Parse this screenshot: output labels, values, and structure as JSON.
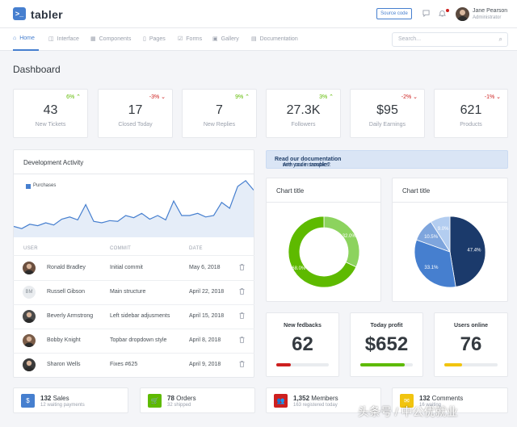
{
  "brand": {
    "name": "tabler",
    "logo_icon": "terminal-icon",
    "accent": "#467fcf"
  },
  "header": {
    "source_button": "Source code",
    "user": {
      "name": "Jane Pearson",
      "role": "Administrator"
    }
  },
  "nav": {
    "items": [
      {
        "label": "Home",
        "icon": "home-icon",
        "active": true
      },
      {
        "label": "Interface",
        "icon": "box-icon"
      },
      {
        "label": "Components",
        "icon": "calendar-icon"
      },
      {
        "label": "Pages",
        "icon": "file-icon"
      },
      {
        "label": "Forms",
        "icon": "check-square-icon"
      },
      {
        "label": "Gallery",
        "icon": "image-icon"
      },
      {
        "label": "Documentation",
        "icon": "file-text-icon"
      }
    ],
    "search_placeholder": "Search..."
  },
  "page": {
    "title": "Dashboard"
  },
  "stats": [
    {
      "value": "43",
      "label": "New Tickets",
      "change": "6%",
      "trend": "up"
    },
    {
      "value": "17",
      "label": "Closed Today",
      "change": "-3%",
      "trend": "down"
    },
    {
      "value": "7",
      "label": "New Replies",
      "change": "9%",
      "trend": "up"
    },
    {
      "value": "27.3K",
      "label": "Followers",
      "change": "3%",
      "trend": "up"
    },
    {
      "value": "$95",
      "label": "Daily Earnings",
      "change": "-2%",
      "trend": "down"
    },
    {
      "value": "621",
      "label": "Products",
      "change": "-1%",
      "trend": "down"
    }
  ],
  "dev": {
    "title": "Development Activity",
    "legend": "Purchases",
    "columns": [
      "USER",
      "COMMIT",
      "DATE"
    ],
    "rows": [
      {
        "user": "Ronald Bradley",
        "commit": "Initial commit",
        "date": "May 6, 2018",
        "initials": ""
      },
      {
        "user": "Russell Gibson",
        "commit": "Main structure",
        "date": "April 22, 2018",
        "initials": "BM"
      },
      {
        "user": "Beverly Armstrong",
        "commit": "Left sidebar adjusments",
        "date": "April 15, 2018",
        "initials": ""
      },
      {
        "user": "Bobby Knight",
        "commit": "Topbar dropdown style",
        "date": "April 8, 2018",
        "initials": ""
      },
      {
        "user": "Sharon Wells",
        "commit": "Fixes #625",
        "date": "April 9, 2018",
        "initials": ""
      }
    ]
  },
  "alert": {
    "prefix": "Are you in trouble? ",
    "link": "Read our documentation",
    "suffix": " with code samples."
  },
  "chart_data": [
    {
      "type": "area",
      "series": [
        {
          "name": "Purchases",
          "values": [
            15,
            12,
            18,
            16,
            20,
            17,
            25,
            28,
            24,
            45,
            22,
            20,
            23,
            22,
            30,
            27,
            33,
            25,
            30,
            24,
            50,
            30,
            30,
            33,
            28,
            30,
            48,
            40,
            70,
            78,
            65
          ]
        }
      ],
      "color": "#467fcf"
    },
    {
      "type": "pie",
      "title": "Chart title",
      "variant": "donut",
      "labels": [
        "32.0%",
        "68.0%"
      ],
      "values": [
        32.0,
        68.0
      ],
      "colors": [
        "#8cd35e",
        "#5eba00"
      ]
    },
    {
      "type": "pie",
      "title": "Chart title",
      "labels": [
        "47.4%",
        "33.1%",
        "10.5%",
        "9.0%"
      ],
      "values": [
        47.4,
        33.1,
        10.5,
        9.0
      ],
      "colors": [
        "#1b3a6b",
        "#467fcf",
        "#7ea5dd",
        "#b3cdf0"
      ]
    }
  ],
  "kpis": [
    {
      "title": "New fedbacks",
      "value": "62",
      "progress": 0.28,
      "color": "#cd201f"
    },
    {
      "title": "Today profit",
      "value": "$652",
      "progress": 0.84,
      "color": "#5eba00"
    },
    {
      "title": "Users online",
      "value": "76",
      "progress": 0.34,
      "color": "#f1c40f"
    }
  ],
  "bottom": [
    {
      "icon": "dollar-icon",
      "color": "#467fcf",
      "count": "132",
      "label": "Sales",
      "sub": "12 waiting payments"
    },
    {
      "icon": "cart-icon",
      "color": "#5eba00",
      "count": "78",
      "label": "Orders",
      "sub": "32 shipped"
    },
    {
      "icon": "users-icon",
      "color": "#cd201f",
      "count": "1,352",
      "label": "Members",
      "sub": "163 registered today"
    },
    {
      "icon": "message-icon",
      "color": "#f1c40f",
      "count": "132",
      "label": "Comments",
      "sub": "16 waiting"
    }
  ],
  "watermark": "头条号 / 中公优就业"
}
